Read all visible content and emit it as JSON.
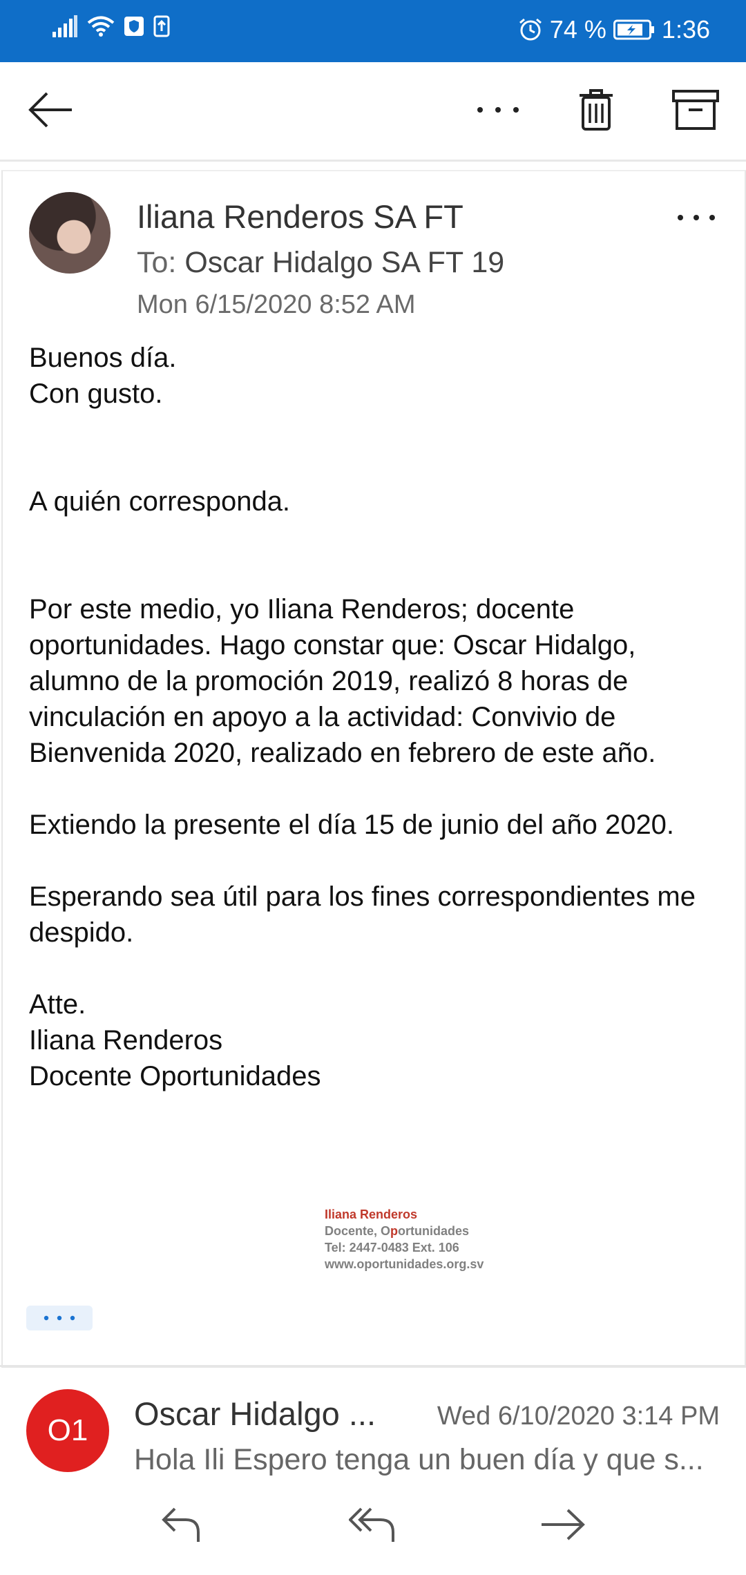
{
  "status_bar": {
    "battery_percent": "74 %",
    "time": "1:36"
  },
  "toolbar": {
    "icons": [
      "back-arrow-icon",
      "more-icon",
      "trash-icon",
      "archive-icon"
    ]
  },
  "message": {
    "sender": "Iliana Renderos SA FT",
    "to_label": "To:",
    "to_name": "Oscar Hidalgo SA FT 19",
    "date": "Mon 6/15/2020 8:52 AM",
    "body": {
      "greeting1": "Buenos día.",
      "greeting2": "Con gusto.",
      "salutation": "A quién corresponda.",
      "paragraph1": "Por este medio, yo Iliana Renderos; docente oportunidades. Hago constar que: Oscar Hidalgo, alumno de la promoción 2019, realizó 8 horas de vinculación en apoyo a la actividad: Convivio de Bienvenida 2020, realizado en febrero de este año.",
      "paragraph2": "Extiendo la presente el día 15 de junio del año 2020.",
      "paragraph3": "Esperando sea útil para los fines correspondientes me despido.",
      "closing": "Atte.",
      "closing_name": "Iliana Renderos",
      "closing_title": "Docente Oportunidades"
    },
    "signature": {
      "name": "Iliana Renderos",
      "title_prefix": "Docente, O",
      "title_accent": "p",
      "title_suffix": "ortunidades",
      "phone": "Tel: 2447-0483 Ext. 106",
      "website": "www.oportunidades.org.sv"
    }
  },
  "message2": {
    "initials": "O1",
    "sender": "Oscar Hidalgo ...",
    "date": "Wed 6/10/2020 3:14 PM",
    "preview": "Hola Ili Espero tenga un buen día y que s..."
  },
  "colors": {
    "status_bar": "#0f6ec8",
    "avatar_initials_bg": "#e02020",
    "signature_accent": "#c0392b"
  }
}
